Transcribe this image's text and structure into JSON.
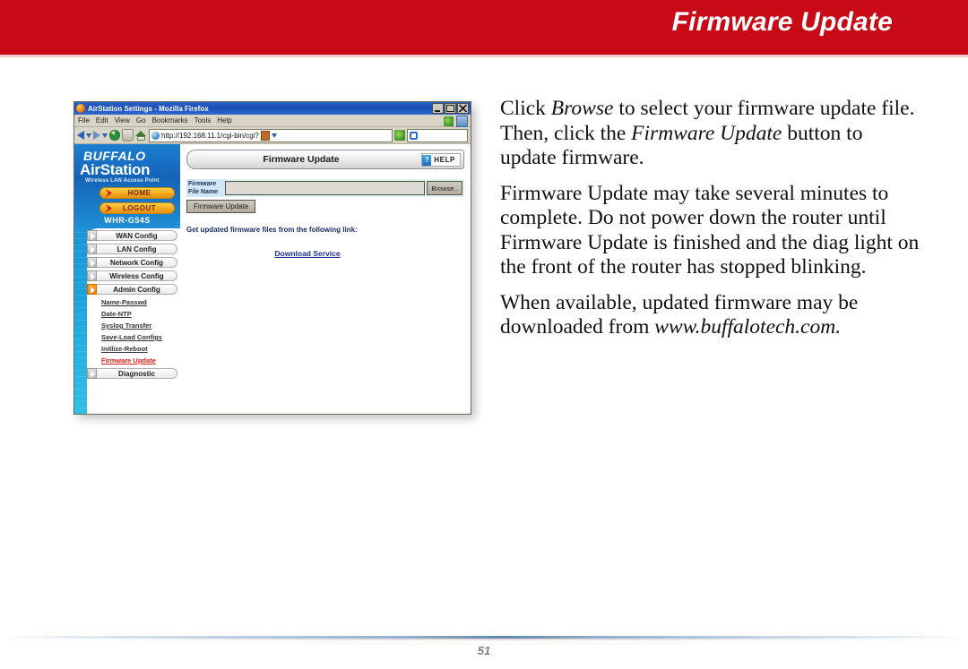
{
  "header": {
    "title": "Firmware Update",
    "bg_color": "#c70a15"
  },
  "footer": {
    "page_number": "51"
  },
  "screenshot": {
    "browser": {
      "title": "AirStation Settings - Mozilla Firefox",
      "window_icon": "firefox-icon",
      "window_buttons": [
        "minimize",
        "maximize",
        "close"
      ],
      "menu": [
        "File",
        "Edit",
        "View",
        "Go",
        "Bookmarks",
        "Tools",
        "Help"
      ],
      "toolbar_icons": [
        "back-icon",
        "back-dropdown-icon",
        "forward-icon",
        "forward-dropdown-icon",
        "reload-icon",
        "stop-icon",
        "home-icon"
      ],
      "url": "http://192.168.11.1/cgi-bin/cgi?",
      "url_icons": [
        "site-globe-icon",
        "lock-icon",
        "url-dropdown-icon"
      ],
      "go_icon": "go-icon",
      "search_icon": "search-engine-icon"
    },
    "router_ui": {
      "brand": {
        "company": "BUFFALO",
        "product": "AirStation",
        "tagline": "Wireless LAN Access Point",
        "model": "WHR-G54S"
      },
      "pills": [
        {
          "label": "HOME",
          "icon": "arrow-right-icon"
        },
        {
          "label": "LOGOUT",
          "icon": "arrow-right-icon"
        }
      ],
      "nav_buttons": [
        {
          "label": "WAN Config",
          "active": false
        },
        {
          "label": "LAN Config",
          "active": false
        },
        {
          "label": "Network Config",
          "active": false
        },
        {
          "label": "Wireless Config",
          "active": false
        },
        {
          "label": "Admin Config",
          "active": true
        }
      ],
      "sub_links": [
        {
          "label": "Name-Passwd",
          "current": false
        },
        {
          "label": "Date-NTP",
          "current": false
        },
        {
          "label": "Syslog Transfer",
          "current": false
        },
        {
          "label": "Save-Load Configs",
          "current": false
        },
        {
          "label": "Initlize-Reboot",
          "current": false
        },
        {
          "label": "Firmware Update",
          "current": true
        }
      ],
      "nav_buttons_bottom": [
        {
          "label": "Diagnostic",
          "active": false
        }
      ],
      "panel": {
        "title": "Firmware Update",
        "help_label": "HELP",
        "help_icon": "question-mark-icon",
        "field_label_line1": "Firmware",
        "field_label_line2": "File Name",
        "field_value": "",
        "browse_label": "Browse..",
        "submit_label": "Firmware Update",
        "note": "Get updated firmware files from the following link:",
        "download_link": "Download Service"
      }
    }
  },
  "body_copy": {
    "paragraph1": [
      {
        "text": "Click ",
        "italic": false
      },
      {
        "text": "Browse",
        "italic": true
      },
      {
        "text": " to select your firmware update file.  Then, click the ",
        "italic": false
      },
      {
        "text": "Firmware Update",
        "italic": true
      },
      {
        "text": " button to update firmware.",
        "italic": false
      }
    ],
    "paragraph2": [
      {
        "text": "Firmware Update may take several minutes to complete.  Do not power down the router until Firmware Update is finished and the diag light on the front of the router has stopped blinking.",
        "italic": false
      }
    ],
    "paragraph3": [
      {
        "text": "When available, updated firmware may be downloaded from ",
        "italic": false
      },
      {
        "text": "www.buffalotech.com.",
        "italic": true
      }
    ]
  }
}
